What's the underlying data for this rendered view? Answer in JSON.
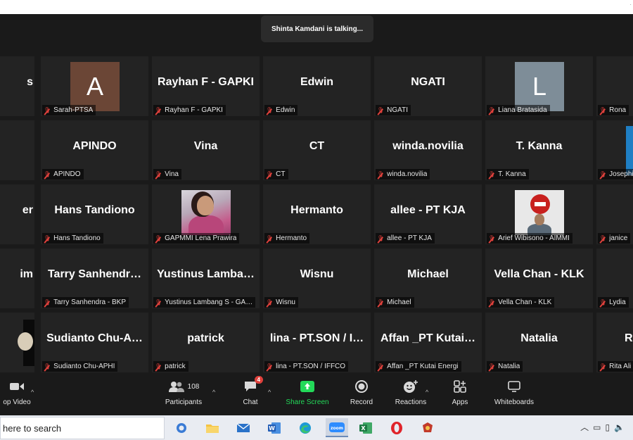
{
  "talking_indicator": "Shinta Kamdani is talking...",
  "colors": {
    "muted": "#e0413c",
    "share_green": "#23d959"
  },
  "tiles": [
    {
      "col": 0,
      "row": 0,
      "display": "s",
      "label": ""
    },
    {
      "col": 1,
      "row": 0,
      "display": "",
      "label": "Sarah-PTSA",
      "avatar": "A",
      "avatar_color": "#6b4636"
    },
    {
      "col": 2,
      "row": 0,
      "display": "Rayhan F - GAPKI",
      "label": "Rayhan F - GAPKI"
    },
    {
      "col": 3,
      "row": 0,
      "display": "Edwin",
      "label": "Edwin"
    },
    {
      "col": 4,
      "row": 0,
      "display": "NGATI",
      "label": "NGATI"
    },
    {
      "col": 5,
      "row": 0,
      "display": "",
      "label": "Liana Bratasida",
      "avatar": "L",
      "avatar_color": "#7e8d98"
    },
    {
      "col": 6,
      "row": 0,
      "display": "",
      "label": "Rona"
    },
    {
      "col": 0,
      "row": 1,
      "display": "",
      "label": ""
    },
    {
      "col": 1,
      "row": 1,
      "display": "APINDO",
      "label": "APINDO"
    },
    {
      "col": 2,
      "row": 1,
      "display": "Vina",
      "label": "Vina"
    },
    {
      "col": 3,
      "row": 1,
      "display": "CT",
      "label": "CT"
    },
    {
      "col": 4,
      "row": 1,
      "display": "winda.novilia",
      "label": "winda.novilia"
    },
    {
      "col": 5,
      "row": 1,
      "display": "T. Kanna",
      "label": "T. Kanna"
    },
    {
      "col": 6,
      "row": 1,
      "display": "",
      "label": "Josephine",
      "avatar": "",
      "avatar_color": "#1f7fc4"
    },
    {
      "col": 0,
      "row": 2,
      "display": "er",
      "label": ""
    },
    {
      "col": 1,
      "row": 2,
      "display": "Hans Tandiono",
      "label": "Hans Tandiono"
    },
    {
      "col": 2,
      "row": 2,
      "display": "",
      "label": "GAPMMI Lena Prawira",
      "photo": "lena"
    },
    {
      "col": 3,
      "row": 2,
      "display": "Hermanto",
      "label": "Hermanto"
    },
    {
      "col": 4,
      "row": 2,
      "display": "allee - PT KJA",
      "label": "allee - PT KJA"
    },
    {
      "col": 5,
      "row": 2,
      "display": "",
      "label": "Arief Wibisono - AIMMI",
      "photo": "arief"
    },
    {
      "col": 6,
      "row": 2,
      "display": "",
      "label": "janice"
    },
    {
      "col": 0,
      "row": 3,
      "display": "im",
      "label": ""
    },
    {
      "col": 1,
      "row": 3,
      "display": "Tarry  Sanhendr…",
      "label": "Tarry Sanhendra - BKP"
    },
    {
      "col": 2,
      "row": 3,
      "display": "Yustinus  Lamba…",
      "label": "Yustinus Lambang S - GA…"
    },
    {
      "col": 3,
      "row": 3,
      "display": "Wisnu",
      "label": "Wisnu"
    },
    {
      "col": 4,
      "row": 3,
      "display": "Michael",
      "label": "Michael"
    },
    {
      "col": 5,
      "row": 3,
      "display": "Vella Chan - KLK",
      "label": "Vella Chan - KLK"
    },
    {
      "col": 6,
      "row": 3,
      "display": "",
      "label": "Lydia"
    },
    {
      "col": 0,
      "row": 4,
      "display": "",
      "label": ""
    },
    {
      "col": 1,
      "row": 4,
      "display": "Sudianto  Chu-A…",
      "label": "Sudianto Chu-APHI"
    },
    {
      "col": 2,
      "row": 4,
      "display": "patrick",
      "label": "patrick"
    },
    {
      "col": 3,
      "row": 4,
      "display": "lina  -  PT.SON  /  I…",
      "label": "lina - PT.SON / IFFCO"
    },
    {
      "col": 4,
      "row": 4,
      "display": "Affan  _PT  Kutai…",
      "label": "Affan _PT Kutai Energi"
    },
    {
      "col": 5,
      "row": 4,
      "display": "Natalia",
      "label": "Natalia"
    },
    {
      "col": 6,
      "row": 4,
      "display": "R",
      "label": "Rita Ali"
    }
  ],
  "toolbar": {
    "video": "op Video",
    "participants": "Participants",
    "participant_count": "108",
    "chat": "Chat",
    "chat_badge": "4",
    "share": "Share Screen",
    "record": "Record",
    "reactions": "Reactions",
    "apps": "Apps",
    "whiteboards": "Whiteboards"
  },
  "taskbar": {
    "search_placeholder": "here to search"
  }
}
